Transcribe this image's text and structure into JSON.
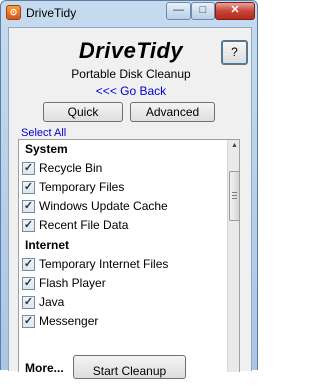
{
  "window": {
    "title": "DriveTidy",
    "minimize_glyph": "—",
    "maximize_glyph": "□",
    "close_glyph": "✕",
    "icon": "drivetidy-app-icon"
  },
  "header": {
    "app_title": "DriveTidy",
    "subtitle": "Portable Disk Cleanup",
    "go_back": "<<< Go Back",
    "help_label": "?"
  },
  "modes": {
    "quick_label": "Quick",
    "advanced_label": "Advanced"
  },
  "select_all": "Select All",
  "groups": [
    {
      "name": "System",
      "items": [
        {
          "label": "Recycle Bin",
          "checked": true
        },
        {
          "label": "Temporary Files",
          "checked": true
        },
        {
          "label": "Windows Update Cache",
          "checked": true
        },
        {
          "label": "Recent File Data",
          "checked": true
        }
      ]
    },
    {
      "name": "Internet",
      "items": [
        {
          "label": "Temporary Internet Files",
          "checked": true
        },
        {
          "label": "Flash Player",
          "checked": true
        },
        {
          "label": "Java",
          "checked": true
        },
        {
          "label": "Messenger",
          "checked": true
        }
      ]
    }
  ],
  "more_label": "More...",
  "start_label": "Start Cleanup",
  "colors": {
    "link": "#0000cc",
    "title_bar": "#a9c6e4",
    "close_button": "#c6453a"
  }
}
